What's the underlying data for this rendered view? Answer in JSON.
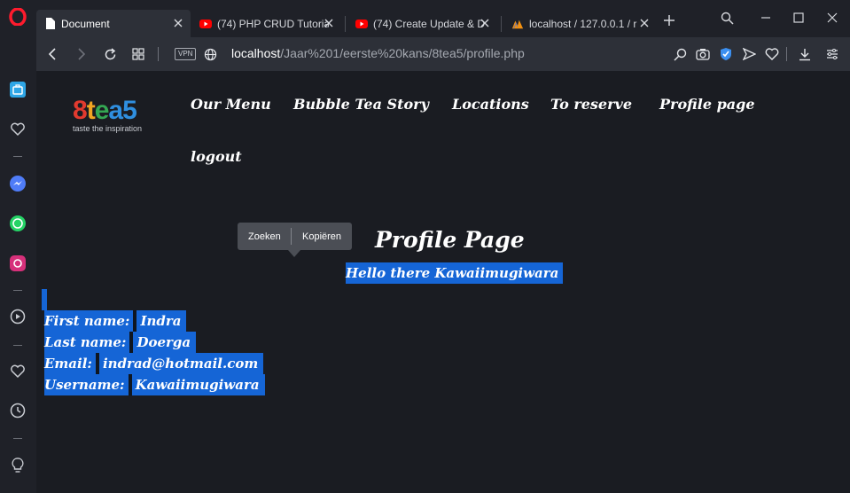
{
  "browser": {
    "tabs": [
      {
        "title": "Document",
        "active": true,
        "favicon": "document-icon"
      },
      {
        "title": "(74) PHP CRUD Tutoria",
        "active": false,
        "favicon": "youtube-icon"
      },
      {
        "title": "(74) Create Update & D",
        "active": false,
        "favicon": "youtube-icon"
      },
      {
        "title": "localhost / 127.0.0.1 / r",
        "active": false,
        "favicon": "phpmyadmin-icon"
      }
    ],
    "vpn_label": "VPN",
    "url_host": "localhost",
    "url_path": "/Jaar%201/eerste%20kans/8tea5/profile.php"
  },
  "site": {
    "logo_text": [
      "8",
      "t",
      "e",
      "a",
      "5"
    ],
    "logo_colors": [
      "#e23a2f",
      "#f1a422",
      "#34a853",
      "#2f8fe0",
      "#2f8fe0"
    ],
    "tagline": "taste the inspiration",
    "nav": [
      "Our Menu",
      "Bubble Tea Story",
      "Locations",
      "To reserve",
      "Profile page",
      "logout"
    ]
  },
  "context_menu": {
    "search": "Zoeken",
    "copy": "Kopiëren"
  },
  "profile": {
    "title": "Profile Page",
    "greeting": "Hello there Kawaiimugiwara",
    "fields": [
      {
        "label": "First name:",
        "value": "Indra"
      },
      {
        "label": "Last name:",
        "value": "Doerga"
      },
      {
        "label": "Email:",
        "value": "indrad@hotmail.com"
      },
      {
        "label": "Username:",
        "value": "Kawaiimugiwara"
      }
    ]
  },
  "colors": {
    "selection": "#1565d6",
    "page_bg": "#1a1c22"
  }
}
